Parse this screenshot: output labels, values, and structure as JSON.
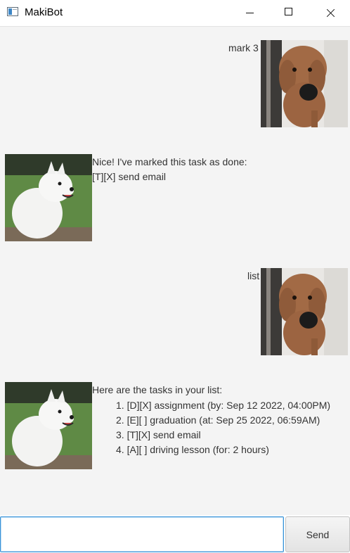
{
  "window": {
    "title": "MakiBot",
    "app_icon": "app-window-icon",
    "controls": [
      "minimize-icon",
      "maximize-icon",
      "close-icon"
    ]
  },
  "messages": [
    {
      "sender": "user",
      "text": "mark 3",
      "avatar": "poodle-avatar"
    },
    {
      "sender": "bot",
      "lines": [
        "Nice! I've marked this task as done:",
        "[T][X] send email"
      ],
      "avatar": "samoyed-avatar"
    },
    {
      "sender": "user",
      "text": "list",
      "avatar": "poodle-avatar"
    },
    {
      "sender": "bot",
      "header": "Here are the tasks in your list:",
      "items": [
        "1. [D][X] assignment (by: Sep 12 2022, 04:00PM)",
        "2. [E][ ] graduation (at: Sep 25 2022, 06:59AM)",
        "3. [T][X] send email",
        "4. [A][ ] driving lesson (for: 2 hours)"
      ],
      "avatar": "samoyed-avatar"
    }
  ],
  "input": {
    "value": "",
    "placeholder": ""
  },
  "send_label": "Send"
}
